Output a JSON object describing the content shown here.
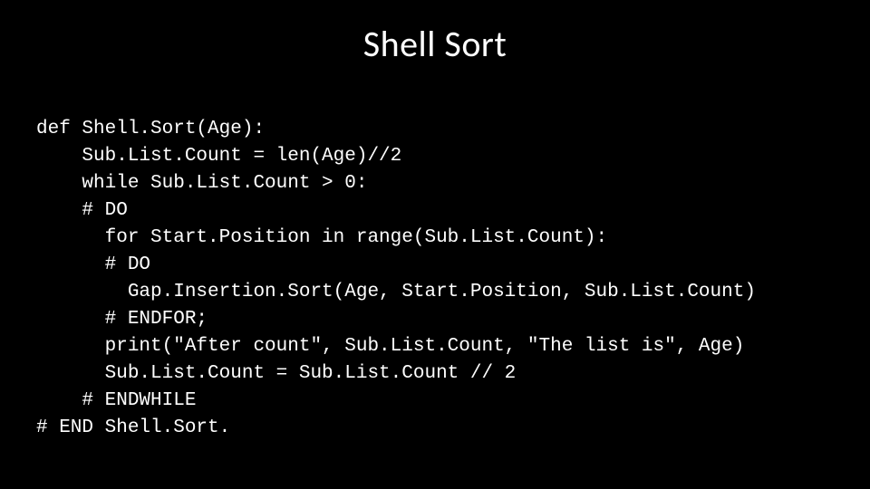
{
  "slide": {
    "title": "Shell Sort",
    "code": "def Shell.Sort(Age):\n    Sub.List.Count = len(Age)//2\n    while Sub.List.Count > 0:\n    # DO\n      for Start.Position in range(Sub.List.Count):\n      # DO\n        Gap.Insertion.Sort(Age, Start.Position, Sub.List.Count)\n      # ENDFOR;\n      print(\"After count\", Sub.List.Count, \"The list is\", Age)\n      Sub.List.Count = Sub.List.Count // 2\n    # ENDWHILE\n# END Shell.Sort."
  }
}
